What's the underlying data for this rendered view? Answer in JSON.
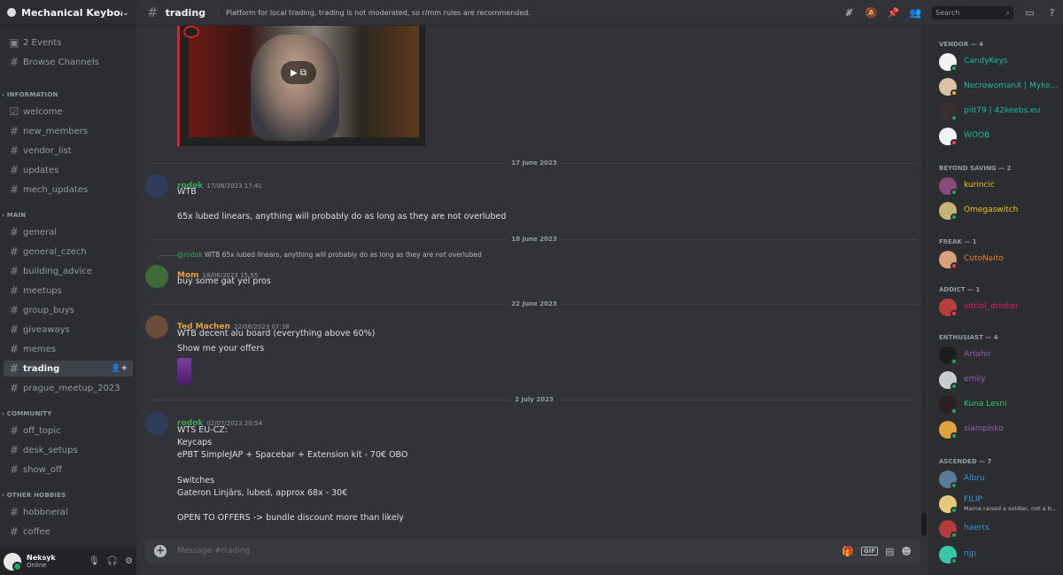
{
  "server": {
    "name": "Mechanical Keyboar...",
    "chevron_icon": "chevron-down-icon"
  },
  "sidebar": {
    "top": [
      {
        "label": "2 Events",
        "icon": "calendar-icon"
      },
      {
        "label": "Browse Channels",
        "icon": "hash-icon"
      }
    ],
    "categories": {
      "information": "INFORMATION",
      "main": "MAIN",
      "community": "COMMUNITY",
      "other": "OTHER HOBBIES"
    },
    "channels": {
      "welcome": "welcome",
      "new_members": "new_members",
      "vendor_list": "vendor_list",
      "updates": "updates",
      "mech_updates": "mech_updates",
      "general": "general",
      "general_czech": "general_czech",
      "building_advice": "building_advice",
      "meetups": "meetups",
      "group_buys": "group_buys",
      "giveaways": "giveaways",
      "memes": "memes",
      "trading": "trading",
      "prague_meetup_2023": "prague_meetup_2023",
      "off_topic": "off_topic",
      "desk_setups": "desk_setups",
      "show_off": "show_off",
      "hobbneral": "hobbneral",
      "coffee": "coffee"
    },
    "active": "trading"
  },
  "user_panel": {
    "name": "Neksyk",
    "status": "Online"
  },
  "channel": {
    "name": "trading",
    "topic": "Platform for local trading, trading is not moderated, so r/mm rules are recommended.",
    "search_placeholder": "Search"
  },
  "dividers": [
    "17 June 2023",
    "18 June 2023",
    "22 June 2023",
    "2 July 2023"
  ],
  "messages": [
    {
      "author": "rodok",
      "author_color": "#3ba55c",
      "timestamp": "17/06/2023 17:41",
      "lines": [
        "WTB",
        "65x lubed linears, anything will probably do as long as they are not overlubed"
      ]
    },
    {
      "author": "Mom",
      "author_color": "#e6a23c",
      "timestamp": "18/06/2023 15:55",
      "reply_to": "@rodok",
      "reply_text": "WTB 65x lubed linears, anything will probably do as long as they are not overlubed",
      "lines": [
        "buy some gat yel pros"
      ]
    },
    {
      "author": "Ted Machen",
      "author_color": "#e6a23c",
      "timestamp": "22/06/2023 07:38",
      "lines": [
        "WTB decent alu board (everything above 60%)",
        "Show me your offers"
      ]
    },
    {
      "author": "rodok",
      "author_color": "#3ba55c",
      "timestamp": "02/07/2023 20:54",
      "lines": [
        "WTS EU-CZ:",
        "Keycaps",
        "ePBT SimpleJAP + Spacebar + Extension kit - 70€ OBO",
        "Switches",
        "Gateron Linjärs, lubed, approx 68x - 30€",
        "OPEN TO OFFERS -> bundle discount more than likely"
      ]
    }
  ],
  "composer": {
    "placeholder": "Message #trading"
  },
  "members": {
    "groups": [
      {
        "title": "VENDOR — 4",
        "people": [
          {
            "name": "CandyKeys",
            "color": "#1abc9c"
          },
          {
            "name": "NecrowomanX | Myke...",
            "color": "#1abc9c"
          },
          {
            "name": "piit79 | 42keebs.eu",
            "color": "#1abc9c"
          },
          {
            "name": "WOOB",
            "color": "#1abc9c"
          }
        ]
      },
      {
        "title": "BEYOND SAVING — 2",
        "people": [
          {
            "name": "kurincic",
            "color": "#f1c40f"
          },
          {
            "name": "Omegaswitch",
            "color": "#f1c40f"
          }
        ]
      },
      {
        "title": "FREAK — 1",
        "people": [
          {
            "name": "CutoNaito",
            "color": "#e67e22"
          }
        ]
      },
      {
        "title": "ADDICT — 1",
        "people": [
          {
            "name": "vitriol_drinker",
            "color": "#e91e63"
          }
        ]
      },
      {
        "title": "ENTHUSIAST — 4",
        "people": [
          {
            "name": "Artahir",
            "color": "#9b59b6"
          },
          {
            "name": "emily",
            "color": "#9b59b6"
          },
          {
            "name": "Kuna Lesni",
            "color": "#2ecc71"
          },
          {
            "name": "slampisko",
            "color": "#9b59b6"
          }
        ]
      },
      {
        "title": "ASCENDED — 7",
        "people": [
          {
            "name": "Albru",
            "color": "#3498db"
          },
          {
            "name": "FILIP",
            "color": "#3498db",
            "sub": "Mama raised a soldier, not a b..."
          },
          {
            "name": "haerts",
            "color": "#3498db"
          },
          {
            "name": "njp",
            "color": "#3498db"
          }
        ]
      }
    ]
  },
  "colors": {
    "accent": "#5865f2",
    "online": "#23a55a",
    "dnd": "#f23f43",
    "idle": "#f0b232"
  }
}
